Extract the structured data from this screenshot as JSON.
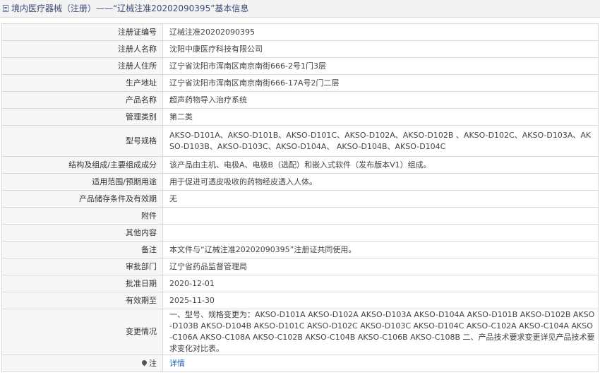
{
  "header": {
    "title": "境内医疗器械（注册）——“辽械注准20202090395”基本信息"
  },
  "rows": [
    {
      "label": "注册证编号",
      "value": "辽械注准20202090395"
    },
    {
      "label": "注册人名称",
      "value": "沈阳中康医疗科技有限公司"
    },
    {
      "label": "注册人住所",
      "value": "辽宁省沈阳市浑南区南京南街666-2号1门3层"
    },
    {
      "label": "生产地址",
      "value": "辽宁省沈阳市浑南区南京南街666-17A号2门二层"
    },
    {
      "label": "产品名称",
      "value": "超声药物导入治疗系统"
    },
    {
      "label": "管理类别",
      "value": "第二类"
    },
    {
      "label": "型号规格",
      "value": "AKSO-D101A、AKSO-D101B、AKSO-D101C、AKSO-D102A、AKSO-D102B 、AKSO-D102C、AKSO-D103A、AKSO-D103B、AKSO-D103C、AKSO-D104A、 AKSO-D104B、AKSO-D104C"
    },
    {
      "label": "结构及组成/主要组成成分",
      "value": "该产品由主机、电极A、电极B（选配）和嵌入式软件（发布版本V1）组成。"
    },
    {
      "label": "适用范围/预期用途",
      "value": "用于促进可透皮吸收的药物经皮透入人体。"
    },
    {
      "label": "产品储存条件及有效期",
      "value": "无"
    },
    {
      "label": "附件",
      "value": ""
    },
    {
      "label": "其他内容",
      "value": ""
    },
    {
      "label": "备注",
      "value": "本文件与“辽械注准20202090395”注册证共同使用。"
    },
    {
      "label": "审批部门",
      "value": "辽宁省药品监督管理局"
    },
    {
      "label": "批准日期",
      "value": "2020-12-01"
    },
    {
      "label": "有效期至",
      "value": "2025-11-30"
    },
    {
      "label": "变更情况",
      "value": "一、型号、规格变更为：AKSO-D101A AKSO-D102A AKSO-D103A AKSO-D104A AKSO-D101B AKSO-D102B AKSO-D103B AKSO-D104B AKSO-D101C AKSO-D102C AKSO-D103C AKSO-D104C AKSO-C102A AKSO-C104A AKSO-C106A AKSO-C108A AKSO-C102B AKSO-C104B AKSO-C106B AKSO-C108B 二、产品技术要求变更详见产品技术要求变化对比表。"
    }
  ],
  "note_row": {
    "label": "注",
    "link": "详情",
    "icon": "location-pin-icon"
  }
}
